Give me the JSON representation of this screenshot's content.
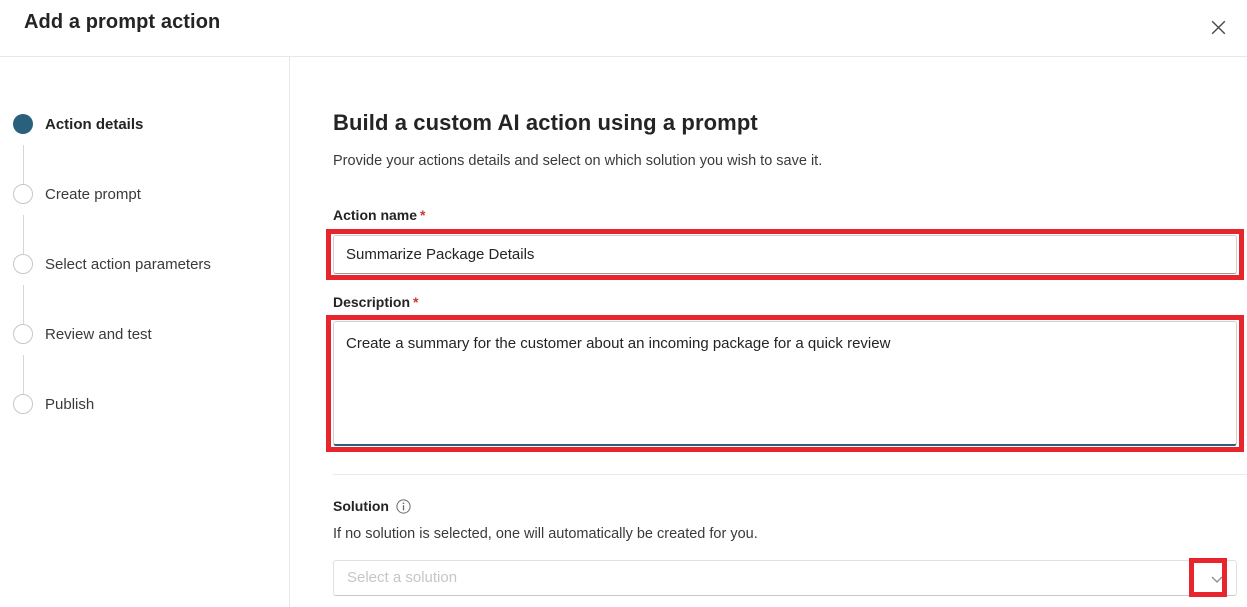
{
  "header": {
    "title": "Add a prompt action",
    "close_icon": "close-icon"
  },
  "wizard": {
    "steps": [
      {
        "label": "Action details",
        "state": "active"
      },
      {
        "label": "Create prompt",
        "state": "inactive"
      },
      {
        "label": "Select action parameters",
        "state": "inactive"
      },
      {
        "label": "Review and test",
        "state": "inactive"
      },
      {
        "label": "Publish",
        "state": "inactive"
      }
    ],
    "active_color": "#29607c",
    "inactive_color": "#c7c7c7"
  },
  "main": {
    "heading": "Build a custom AI action using a prompt",
    "subheading": "Provide your actions details and select on which solution you wish to save it.",
    "action_name": {
      "label": "Action name",
      "required_marker": "*",
      "value": "Summarize Package Details",
      "placeholder": ""
    },
    "description": {
      "label": "Description",
      "required_marker": "*",
      "value": "Create a summary for the customer about an incoming package for a quick review",
      "placeholder": ""
    },
    "solution": {
      "label": "Solution",
      "info_icon": "info-icon",
      "help_text": "If no solution is selected, one will automatically be created for you.",
      "placeholder": "Select a solution",
      "chevron_icon": "chevron-down-icon"
    }
  },
  "annotations": {
    "highlight_color": "#e8242c",
    "boxes": [
      "action-name-field",
      "description-field",
      "solution-dropdown-chevron"
    ]
  }
}
